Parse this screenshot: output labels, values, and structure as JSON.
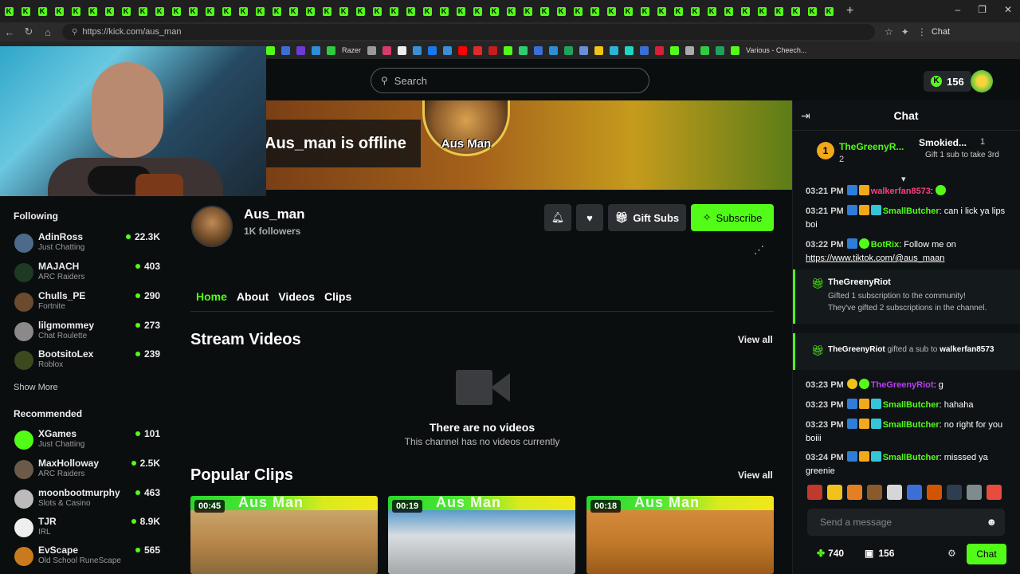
{
  "browser": {
    "url": "https://kick.com/aus_man",
    "tab_right_label": "Chat",
    "bookmarks": [
      "Razer",
      "Various - Cheech..."
    ]
  },
  "header": {
    "search_placeholder": "Search",
    "kicks_balance": "156"
  },
  "banner": {
    "offline_text": "Aus_man is offline",
    "logo_text": "Aus Man"
  },
  "sidebar": {
    "following_title": "Following",
    "following": [
      {
        "name": "AdinRoss",
        "category": "Just Chatting",
        "viewers": "22.3K",
        "color": "#4c6b8a"
      },
      {
        "name": "MAJACH",
        "category": "ARC Raiders",
        "viewers": "403",
        "color": "#1f3a24"
      },
      {
        "name": "Chulls_PE",
        "category": "Fortnite",
        "viewers": "290",
        "color": "#6b4a2e"
      },
      {
        "name": "lilgmommey",
        "category": "Chat Roulette",
        "viewers": "273",
        "color": "#8a8a8a"
      },
      {
        "name": "BootsitoLex",
        "category": "Roblox",
        "viewers": "239",
        "color": "#3a4a1e"
      }
    ],
    "show_more": "Show More",
    "recommended_title": "Recommended",
    "recommended": [
      {
        "name": "XGames",
        "category": "Just Chatting",
        "viewers": "101",
        "color": "#53fc18"
      },
      {
        "name": "MaxHolloway",
        "category": "ARC Raiders",
        "viewers": "2.5K",
        "color": "#6b5a4a"
      },
      {
        "name": "moonbootmurphy",
        "category": "Slots & Casino",
        "viewers": "463",
        "color": "#bbbbbb"
      },
      {
        "name": "TJR",
        "category": "IRL",
        "viewers": "8.9K",
        "color": "#eeeeee"
      },
      {
        "name": "EvScape",
        "category": "Old School RuneScape",
        "viewers": "565",
        "color": "#c97a1e"
      }
    ]
  },
  "channel": {
    "name": "Aus_man",
    "followers": "1K followers",
    "gift_subs_label": "Gift Subs",
    "subscribe_label": "Subscribe",
    "tabs": [
      "Home",
      "About",
      "Videos",
      "Clips"
    ],
    "stream_videos_title": "Stream Videos",
    "view_all": "View all",
    "no_videos_title": "There are no videos",
    "no_videos_sub": "This channel has no videos currently",
    "popular_clips_title": "Popular Clips",
    "clips": [
      {
        "duration": "00:45",
        "watermark": "Aus Man"
      },
      {
        "duration": "00:19",
        "watermark": "Aus Man"
      },
      {
        "duration": "00:18",
        "watermark": "Aus Man"
      }
    ]
  },
  "chat": {
    "title": "Chat",
    "pinned": {
      "rank": "1",
      "name": "TheGreenyR...",
      "count": "2",
      "second_name": "Smokied...",
      "second_count": "1",
      "second_sub": "Gift 1 sub to take 3rd"
    },
    "messages": [
      {
        "time": "03:21 PM",
        "user": "walkerfan8573",
        "text": "",
        "user_color": "#ff3f7f"
      },
      {
        "time": "03:21 PM",
        "user": "SmallButcher",
        "text": "can i lick ya lips boi",
        "user_color": "#53fc18"
      },
      {
        "time": "03:22 PM",
        "user": "BotRix",
        "text": "Follow me on",
        "link": "https://www.tiktok.com/@aus_maan",
        "user_color": "#53fc18"
      },
      {
        "time": "03:23 PM",
        "user": "TheGreenyRiot",
        "text": "g",
        "user_color": "#b93ff5"
      },
      {
        "time": "03:23 PM",
        "user": "SmallButcher",
        "text": "hahaha",
        "user_color": "#53fc18"
      },
      {
        "time": "03:23 PM",
        "user": "SmallButcher",
        "text": "no right for you boiii",
        "user_color": "#53fc18"
      },
      {
        "time": "03:24 PM",
        "user": "SmallButcher",
        "text": "misssed ya greenie",
        "user_color": "#53fc18"
      }
    ],
    "gift_event": {
      "user": "TheGreenyRiot",
      "line1": "Gifted 1 subscription to the community!",
      "line2": "They've gifted 2 subscriptions in the channel."
    },
    "gift_sub_event": {
      "user": "TheGreenyRiot",
      "middle": "gifted a sub to",
      "target": "walkerfan8573"
    },
    "send_placeholder": "Send a message",
    "kicks_count": "740",
    "gift_count": "156",
    "chat_button": "Chat"
  }
}
